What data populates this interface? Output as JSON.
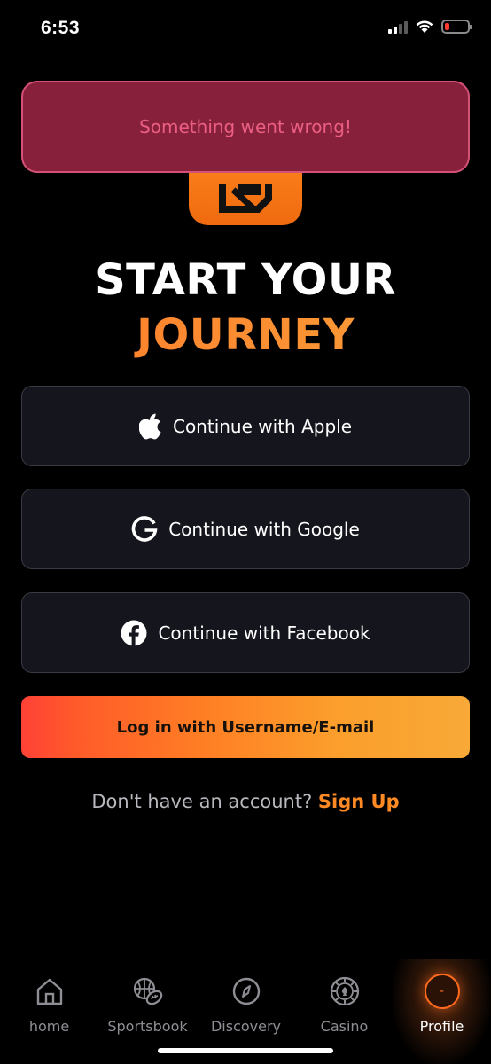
{
  "status_bar": {
    "time": "6:53",
    "battery_level": 0.15,
    "signal_bars": 4,
    "signal_active": 2
  },
  "toast": {
    "message": "Something went wrong!"
  },
  "headline": {
    "line1": "START YOUR",
    "line2": "JOURNEY"
  },
  "auth": {
    "apple_label": "Continue with Apple",
    "google_label": "Continue with Google",
    "facebook_label": "Continue with Facebook",
    "login_label": "Log in with Username/E-mail"
  },
  "signup": {
    "prompt": "Don't have an account?",
    "link": "Sign Up"
  },
  "nav": {
    "items": [
      {
        "label": "home",
        "icon": "house-icon"
      },
      {
        "label": "Sportsbook",
        "icon": "sports-balls-icon"
      },
      {
        "label": "Discovery",
        "icon": "compass-icon"
      },
      {
        "label": "Casino",
        "icon": "poker-chip-icon"
      },
      {
        "label": "Profile",
        "icon": "profile-avatar-icon",
        "avatar_text": "-",
        "active": true
      }
    ]
  },
  "colors": {
    "accent": "#ff7a24",
    "toast_bg": "#87213b",
    "toast_text": "#ec5f83",
    "button_bg": "#15151d"
  }
}
